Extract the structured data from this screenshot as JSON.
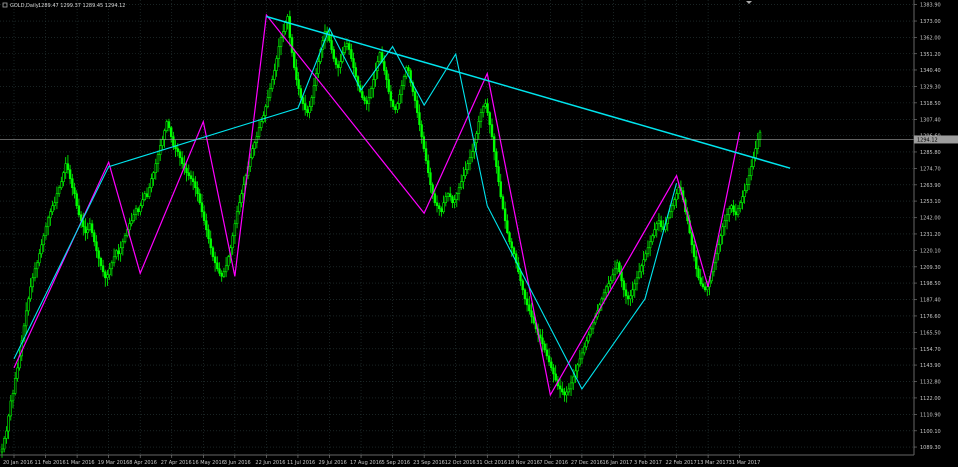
{
  "header": {
    "symbol_timeframe": "GOLD,Daily",
    "ohlc": "1289.47 1299.37 1289.45 1294.12"
  },
  "price_tag": "1294.12",
  "colors": {
    "background": "#000000",
    "grid": "#2a3a3a",
    "bull_candle": "#00ff00",
    "zigzag_magenta": "#ff00ff",
    "zigzag_cyan": "#00e5ee",
    "trendline": "#00e5ee",
    "axis_text": "#c8c8c8",
    "price_line": "#9e9e9e"
  },
  "chart_data": {
    "type": "candlestick",
    "y_ticks": [
      "1383.90",
      "1373.00",
      "1362.00",
      "1351.20",
      "1340.40",
      "1329.30",
      "1318.50",
      "1307.40",
      "1296.60",
      "1285.80",
      "1274.70",
      "1263.90",
      "1253.10",
      "1242.00",
      "1231.20",
      "1220.10",
      "1209.30",
      "1198.50",
      "1187.40",
      "1176.60",
      "1165.50",
      "1154.70",
      "1143.90",
      "1132.80",
      "1122.00",
      "1110.90",
      "1100.10",
      "1089.30"
    ],
    "ylim": [
      1084,
      1387
    ],
    "x_ticks": [
      "20 Jan 2016",
      "11 Feb 2016",
      "1 Mar 2016",
      "19 Mar 2016",
      "8 Apr 2016",
      "27 Apr 2016",
      "16 May 2016",
      "3 Jun 2016",
      "22 Jun 2016",
      "11 Jul 2016",
      "29 Jul 2016",
      "17 Aug 2016",
      "5 Sep 2016",
      "23 Sep 2016",
      "12 Oct 2016",
      "31 Oct 2016",
      "18 Nov 2016",
      "7 Dec 2016",
      "27 Dec 2016",
      "16 Jan 2017",
      "3 Feb 2017",
      "22 Feb 2017",
      "13 Mar 2017",
      "31 Mar 2017"
    ],
    "series": [
      {
        "kind": "price",
        "values": [
          1088,
          1095,
          1100,
          1110,
          1120,
          1125,
          1135,
          1142,
          1150,
          1160,
          1170,
          1180,
          1188,
          1196,
          1202,
          1208,
          1212,
          1218,
          1224,
          1230,
          1236,
          1242,
          1246,
          1250,
          1252,
          1258,
          1262,
          1266,
          1272,
          1278,
          1274,
          1268,
          1262,
          1258,
          1250,
          1244,
          1240,
          1236,
          1232,
          1234,
          1238,
          1232,
          1226,
          1220,
          1215,
          1210,
          1206,
          1202,
          1204,
          1208,
          1212,
          1216,
          1220,
          1218,
          1222,
          1226,
          1230,
          1234,
          1238,
          1240,
          1244,
          1248,
          1246,
          1250,
          1254,
          1258,
          1256,
          1262,
          1268,
          1272,
          1278,
          1284,
          1290,
          1294,
          1300,
          1306,
          1302,
          1296,
          1290,
          1288,
          1286,
          1282,
          1278,
          1275,
          1272,
          1270,
          1268,
          1266,
          1262,
          1258,
          1252,
          1246,
          1240,
          1234,
          1228,
          1222,
          1216,
          1212,
          1208,
          1205,
          1203,
          1206,
          1210,
          1216,
          1222,
          1230,
          1238,
          1246,
          1252,
          1258,
          1264,
          1270,
          1276,
          1282,
          1288,
          1292,
          1296,
          1302,
          1306,
          1310,
          1316,
          1322,
          1328,
          1334,
          1340,
          1348,
          1356,
          1362,
          1366,
          1372,
          1376,
          1362,
          1352,
          1342,
          1334,
          1328,
          1322,
          1318,
          1314,
          1312,
          1316,
          1322,
          1330,
          1338,
          1346,
          1354,
          1360,
          1366,
          1364,
          1360,
          1354,
          1348,
          1344,
          1342,
          1346,
          1352,
          1356,
          1358,
          1354,
          1348,
          1342,
          1336,
          1330,
          1326,
          1322,
          1320,
          1318,
          1322,
          1328,
          1334,
          1340,
          1346,
          1352,
          1346,
          1340,
          1334,
          1326,
          1320,
          1316,
          1314,
          1318,
          1324,
          1330,
          1336,
          1342,
          1340,
          1332,
          1326,
          1320,
          1312,
          1304,
          1296,
          1288,
          1280,
          1272,
          1264,
          1258,
          1252,
          1250,
          1248,
          1246,
          1252,
          1256,
          1258,
          1256,
          1252,
          1254,
          1258,
          1262,
          1266,
          1270,
          1274,
          1278,
          1282,
          1286,
          1292,
          1298,
          1306,
          1312,
          1316,
          1318,
          1312,
          1304,
          1296,
          1286,
          1276,
          1266,
          1256,
          1248,
          1240,
          1232,
          1226,
          1222,
          1218,
          1212,
          1206,
          1200,
          1194,
          1188,
          1184,
          1180,
          1176,
          1172,
          1168,
          1164,
          1162,
          1158,
          1154,
          1150,
          1146,
          1142,
          1138,
          1134,
          1130,
          1128,
          1126,
          1124,
          1126,
          1128,
          1132,
          1136,
          1140,
          1144,
          1148,
          1152,
          1156,
          1160,
          1164,
          1168,
          1172,
          1176,
          1180,
          1184,
          1188,
          1192,
          1196,
          1198,
          1200,
          1204,
          1208,
          1212,
          1206,
          1200,
          1194,
          1190,
          1188,
          1190,
          1194,
          1198,
          1202,
          1206,
          1210,
          1214,
          1218,
          1222,
          1226,
          1230,
          1234,
          1238,
          1240,
          1236,
          1234,
          1238,
          1242,
          1246,
          1250,
          1254,
          1258,
          1262,
          1260,
          1254,
          1246,
          1240,
          1232,
          1224,
          1216,
          1208,
          1202,
          1198,
          1196,
          1194,
          1196,
          1200,
          1206,
          1212,
          1218,
          1224,
          1230,
          1236,
          1240,
          1244,
          1248,
          1250,
          1246,
          1244,
          1248,
          1252,
          1256,
          1260,
          1264,
          1270,
          1276,
          1282,
          1288,
          1294,
          1299
        ]
      },
      {
        "kind": "zigzag",
        "name": "",
        "values": []
      }
    ],
    "zigzag_magenta": [
      {
        "date_index": 0,
        "price": 1142
      },
      {
        "date_index": 3,
        "price": 1279
      },
      {
        "date_index": 4,
        "price": 1205
      },
      {
        "date_index": 6,
        "price": 1306
      },
      {
        "date_index": 7,
        "price": 1203
      },
      {
        "date_index": 8,
        "price": 1377
      },
      {
        "date_index": 13,
        "price": 1245
      },
      {
        "date_index": 15,
        "price": 1338
      },
      {
        "date_index": 17,
        "price": 1124
      },
      {
        "date_index": 21,
        "price": 1270
      },
      {
        "date_index": 22,
        "price": 1196
      },
      {
        "date_index": 23,
        "price": 1299
      }
    ],
    "zigzag_cyan": [
      {
        "date_index": 0,
        "price": 1148
      },
      {
        "date_index": 3,
        "price": 1276
      },
      {
        "date_index": 9,
        "price": 1315
      },
      {
        "date_index": 10,
        "price": 1368
      },
      {
        "date_index": 11,
        "price": 1327
      },
      {
        "date_index": 12,
        "price": 1356
      },
      {
        "date_index": 13,
        "price": 1317
      },
      {
        "date_index": 14,
        "price": 1351
      },
      {
        "date_index": 15,
        "price": 1250
      },
      {
        "date_index": 18,
        "price": 1128
      },
      {
        "date_index": 20,
        "price": 1188
      },
      {
        "date_index": 21,
        "price": 1265
      }
    ],
    "trendline": {
      "start": {
        "date_index": 8,
        "price": 1376
      },
      "end": {
        "date_index": 24.6,
        "price": 1275
      }
    },
    "current_price": 1294.12,
    "grid": true
  },
  "icons": {
    "top_marker": "triangle-down-icon"
  }
}
